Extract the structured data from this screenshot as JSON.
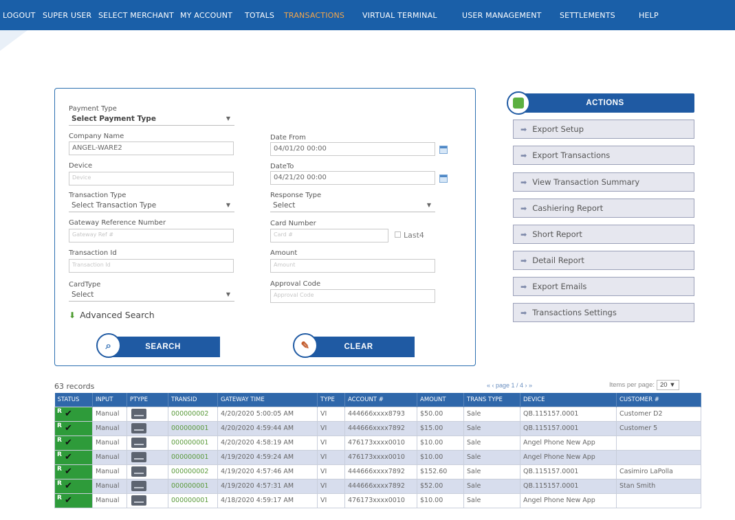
{
  "nav": [
    {
      "label": "LOGOUT",
      "active": false
    },
    {
      "label": "SUPER USER",
      "active": false
    },
    {
      "label": "SELECT MERCHANT",
      "active": false
    },
    {
      "label": "MY ACCOUNT",
      "active": false
    },
    {
      "label": "TOTALS",
      "active": false
    },
    {
      "label": "TRANSACTIONS",
      "active": true
    },
    {
      "label": "VIRTUAL TERMINAL",
      "active": false
    },
    {
      "label": "USER MANAGEMENT",
      "active": false
    },
    {
      "label": "SETTLEMENTS",
      "active": false
    },
    {
      "label": "HELP",
      "active": false
    }
  ],
  "search": {
    "payment_type_label": "Payment Type",
    "payment_type_value": "Select Payment Type",
    "company_name_label": "Company Name",
    "company_name_value": "ANGEL-WARE2",
    "device_label": "Device",
    "device_placeholder": "Device",
    "transaction_type_label": "Transaction Type",
    "transaction_type_value": "Select Transaction Type",
    "gateway_ref_label": "Gateway Reference Number",
    "gateway_ref_placeholder": "Gateway Ref #",
    "transaction_id_label": "Transaction Id",
    "transaction_id_placeholder": "Transaction Id",
    "card_type_label": "CardType",
    "card_type_value": "Select",
    "date_from_label": "Date From",
    "date_from_value": "04/01/20 00:00",
    "date_to_label": "DateTo",
    "date_to_value": "04/21/20 00:00",
    "response_type_label": "Response Type",
    "response_type_value": "Select",
    "card_number_label": "Card Number",
    "card_number_placeholder": "Card #",
    "last4_label": "Last4",
    "amount_label": "Amount",
    "amount_placeholder": "Amount",
    "approval_code_label": "Approval Code",
    "approval_code_placeholder": "Approval Code",
    "advanced_search_label": "Advanced Search",
    "search_button": "SEARCH",
    "clear_button": "CLEAR"
  },
  "actions": {
    "title": "ACTIONS",
    "items": [
      "Export Setup",
      "Export Transactions",
      "View Transaction Summary",
      "Cashiering Report",
      "Short Report",
      "Detail Report",
      "Export Emails",
      "Transactions Settings"
    ]
  },
  "results": {
    "records": "63 records",
    "pager": "« ‹ page 1 / 4 › »",
    "items_per_page_label": "Items per page:",
    "items_per_page_value": "20",
    "columns": [
      "STATUS",
      "INPUT",
      "PTYPE",
      "TRANSID",
      "GATEWAY TIME",
      "TYPE",
      "ACCOUNT #",
      "AMOUNT",
      "TRANS TYPE",
      "DEVICE",
      "CUSTOMER #"
    ],
    "rows": [
      {
        "status": "R",
        "input": "Manual",
        "transid": "000000002",
        "time": "4/20/2020 5:00:05 AM",
        "type": "VI",
        "account": "444666xxxx8793",
        "amount": "$50.00",
        "trans_type": "Sale",
        "device": "QB.115157.0001",
        "customer": "Customer D2"
      },
      {
        "status": "R",
        "input": "Manual",
        "transid": "000000001",
        "time": "4/20/2020 4:59:44 AM",
        "type": "VI",
        "account": "444666xxxx7892",
        "amount": "$15.00",
        "trans_type": "Sale",
        "device": "QB.115157.0001",
        "customer": "Customer 5"
      },
      {
        "status": "R",
        "input": "Manual",
        "transid": "000000001",
        "time": "4/20/2020 4:58:19 AM",
        "type": "VI",
        "account": "476173xxxx0010",
        "amount": "$10.00",
        "trans_type": "Sale",
        "device": "Angel Phone New App",
        "customer": ""
      },
      {
        "status": "R",
        "input": "Manual",
        "transid": "000000001",
        "time": "4/19/2020 4:59:24 AM",
        "type": "VI",
        "account": "476173xxxx0010",
        "amount": "$10.00",
        "trans_type": "Sale",
        "device": "Angel Phone New App",
        "customer": ""
      },
      {
        "status": "R",
        "input": "Manual",
        "transid": "000000002",
        "time": "4/19/2020 4:57:46 AM",
        "type": "VI",
        "account": "444666xxxx7892",
        "amount": "$152.60",
        "trans_type": "Sale",
        "device": "QB.115157.0001",
        "customer": "Casimiro LaPolla"
      },
      {
        "status": "R",
        "input": "Manual",
        "transid": "000000001",
        "time": "4/19/2020 4:57:31 AM",
        "type": "VI",
        "account": "444666xxxx7892",
        "amount": "$52.00",
        "trans_type": "Sale",
        "device": "QB.115157.0001",
        "customer": "Stan Smith"
      },
      {
        "status": "R",
        "input": "Manual",
        "transid": "000000001",
        "time": "4/18/2020 4:59:17 AM",
        "type": "VI",
        "account": "476173xxxx0010",
        "amount": "$10.00",
        "trans_type": "Sale",
        "device": "Angel Phone New App",
        "customer": ""
      }
    ]
  },
  "colors": {
    "nav_bg": "#1a5fa8",
    "nav_active": "#f4a64a",
    "header_blue": "#1f5aa3",
    "status_green": "#2e9b3a"
  },
  "icons": {
    "search": "magnifier-icon",
    "clear": "broom-icon",
    "actions": "export-icon",
    "advanced": "arrow-down-icon",
    "action_arrow": "arrow-right-icon"
  }
}
